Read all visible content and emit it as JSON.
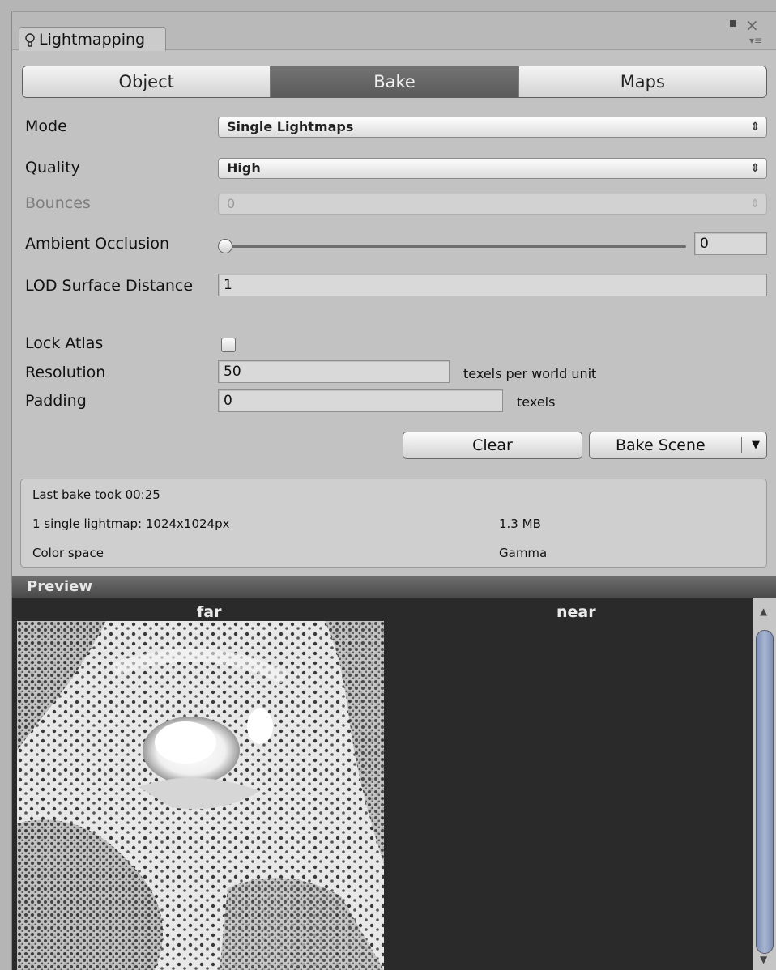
{
  "window": {
    "tab_title": "Lightmapping",
    "tab_icon": "lightbulb-icon"
  },
  "segments": {
    "items": [
      "Object",
      "Bake",
      "Maps"
    ],
    "active": "Bake"
  },
  "form": {
    "mode": {
      "label": "Mode",
      "value": "Single Lightmaps"
    },
    "quality": {
      "label": "Quality",
      "value": "High"
    },
    "bounces": {
      "label": "Bounces",
      "value": "0"
    },
    "ambient_occlusion": {
      "label": "Ambient Occlusion",
      "value": "0",
      "slider_fraction": 0
    },
    "lod_surface_distance": {
      "label": "LOD Surface Distance",
      "value": "1"
    },
    "lock_atlas": {
      "label": "Lock Atlas",
      "checked": false
    },
    "resolution": {
      "label": "Resolution",
      "value": "50",
      "suffix": "texels per world unit"
    },
    "padding": {
      "label": "Padding",
      "value": "0",
      "suffix": "texels"
    }
  },
  "actions": {
    "clear": "Clear",
    "bake_scene": "Bake Scene"
  },
  "info": {
    "last_bake": "Last bake took 00:25",
    "lightmap_desc": "1 single lightmap: 1024x1024px",
    "lightmap_size": "1.3 MB",
    "color_space_label": "Color space",
    "color_space_value": "Gamma"
  },
  "preview": {
    "title": "Preview",
    "far_label": "far",
    "near_label": "near"
  },
  "colors": {
    "active_segment": "#5f5f5f",
    "preview_bg": "#2a2a2a",
    "scroll_thumb": "#8e9dbf"
  }
}
